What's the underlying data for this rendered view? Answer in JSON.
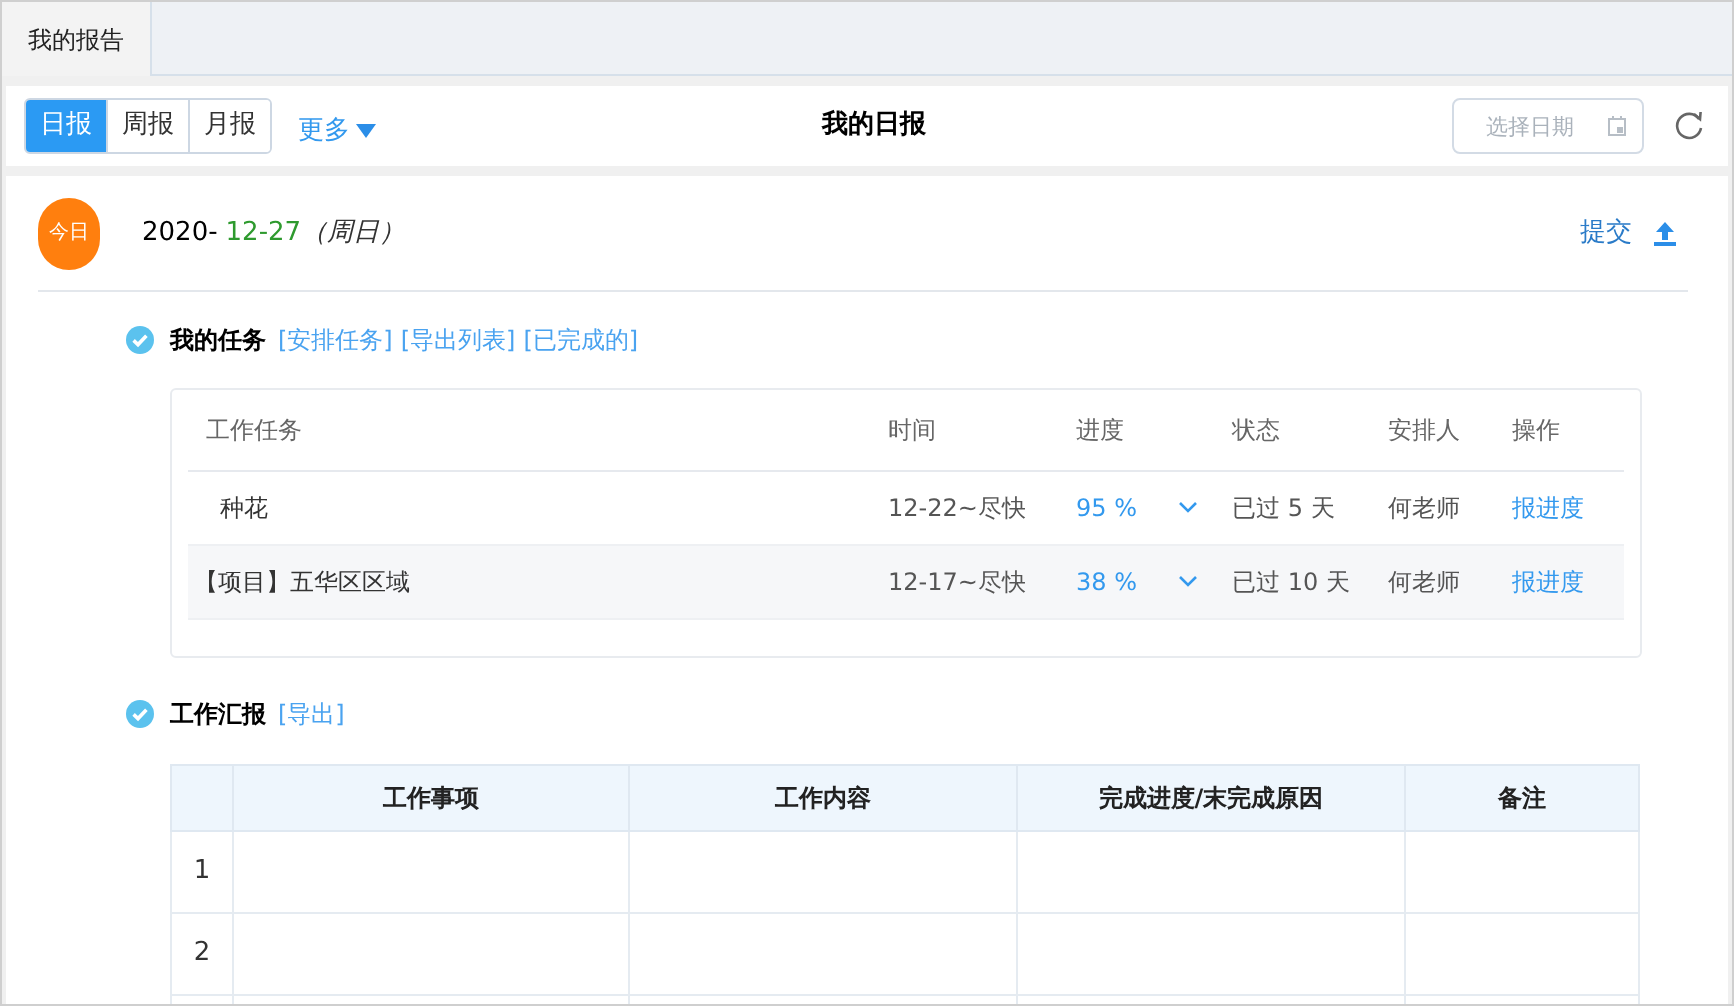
{
  "page_tabs": [
    {
      "label": "我的报告",
      "selected": true
    }
  ],
  "period_tabs": [
    {
      "label": "日报",
      "selected": true
    },
    {
      "label": "周报",
      "selected": false
    },
    {
      "label": "月报",
      "selected": false
    }
  ],
  "more": "更多",
  "title": "我的日报",
  "date_picker": {
    "placeholder": "选择日期"
  },
  "day": {
    "badge": "今日",
    "year": "2020-",
    "date": "12-27",
    "weekday": "（周日）",
    "submit": "提交"
  },
  "tasks": {
    "title": "我的任务",
    "links": [
      "[安排任务]",
      "[导出列表]",
      "[已完成的]"
    ],
    "columns": [
      "工作任务",
      "时间",
      "进度",
      "状态",
      "安排人",
      "操作"
    ],
    "rows": [
      {
        "task": "种花",
        "time": "12-22~尽快",
        "progress": "95 %",
        "status": "已过 5 天",
        "assignee": "何老师",
        "action": "报进度"
      },
      {
        "task": "【项目】五华区区域",
        "time": "12-17~尽快",
        "progress": "38 %",
        "status": "已过 10 天",
        "assignee": "何老师",
        "action": "报进度"
      }
    ]
  },
  "report": {
    "title": "工作汇报",
    "links": [
      "[导出]"
    ],
    "columns": [
      "工作事项",
      "工作内容",
      "完成进度/末完成原因",
      "备注"
    ],
    "rows": [
      {
        "number": "1"
      },
      {
        "number": "2"
      },
      {}
    ]
  }
}
